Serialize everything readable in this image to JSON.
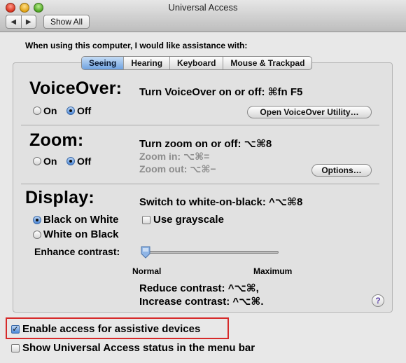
{
  "window": {
    "title": "Universal Access"
  },
  "toolbar": {
    "back": "◀",
    "forward": "▶",
    "show_all": "Show All"
  },
  "intro": "When using this computer, I would like assistance with:",
  "tabs": [
    "Seeing",
    "Hearing",
    "Keyboard",
    "Mouse & Trackpad"
  ],
  "active_tab": "Seeing",
  "voiceover": {
    "title": "VoiceOver:",
    "shortcut": "Turn VoiceOver on or off: ⌘fn F5",
    "on": "On",
    "off": "Off",
    "selected": "Off",
    "utility_button": "Open VoiceOver Utility…"
  },
  "zoom": {
    "title": "Zoom:",
    "shortcut": "Turn zoom on or off: ⌥⌘8",
    "zoom_in": "Zoom in: ⌥⌘=",
    "zoom_out": "Zoom out: ⌥⌘−",
    "on": "On",
    "off": "Off",
    "selected": "Off",
    "options_button": "Options…"
  },
  "display": {
    "title": "Display:",
    "switch": "Switch to white-on-black: ^⌥⌘8",
    "black_on_white": "Black on White",
    "white_on_black": "White on Black",
    "selected": "Black on White",
    "grayscale": "Use grayscale",
    "grayscale_checked": false,
    "enhance_contrast": "Enhance contrast:",
    "contrast_level": 0,
    "min_label": "Normal",
    "max_label": "Maximum",
    "reduce": "Reduce contrast: ^⌥⌘,",
    "increase": "Increase contrast: ^⌥⌘."
  },
  "help": "?",
  "enable_access": {
    "label": "Enable access for assistive devices",
    "checked": true
  },
  "show_status": {
    "label": "Show Universal Access status in the menu bar",
    "checked": false
  },
  "colors": {
    "highlight": "#d62a2a",
    "accent": "#4a86d6"
  }
}
